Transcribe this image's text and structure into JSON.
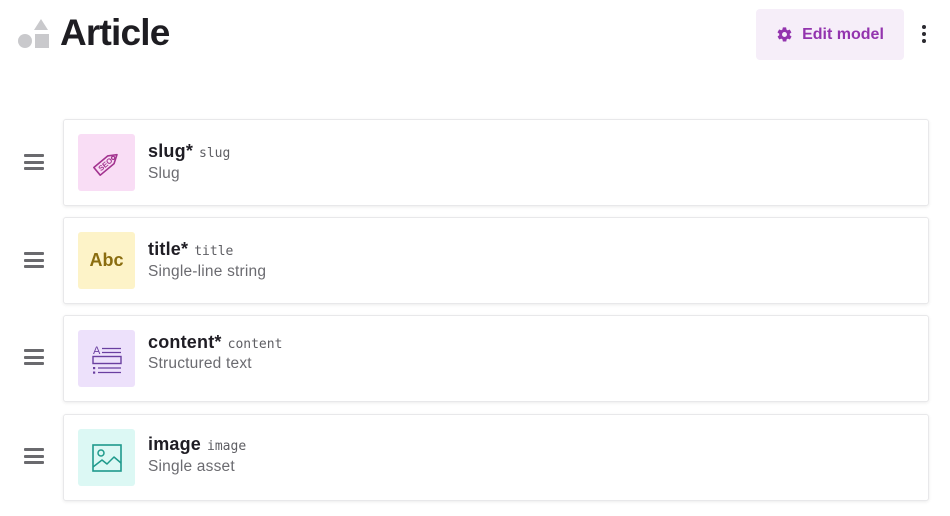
{
  "header": {
    "title": "Article",
    "edit_button_label": "Edit model"
  },
  "colors": {
    "accent": "#9334ae",
    "edit_button_bg": "#f6eef9"
  },
  "fields": [
    {
      "name": "slug",
      "required_marker": "*",
      "api_key": "slug",
      "type_label": "Slug",
      "icon": "seo-tag-icon",
      "tile_color": "#f9ddf5"
    },
    {
      "name": "title",
      "required_marker": "*",
      "api_key": "title",
      "type_label": "Single-line string",
      "icon": "abc-icon",
      "tile_text": "Abc",
      "tile_color": "#fdf3c8"
    },
    {
      "name": "content",
      "required_marker": "*",
      "api_key": "content",
      "type_label": "Structured text",
      "icon": "structured-text-icon",
      "tile_color": "#ede1fb"
    },
    {
      "name": "image",
      "required_marker": "",
      "api_key": "image",
      "type_label": "Single asset",
      "icon": "image-icon",
      "tile_color": "#dcf8f4"
    }
  ]
}
